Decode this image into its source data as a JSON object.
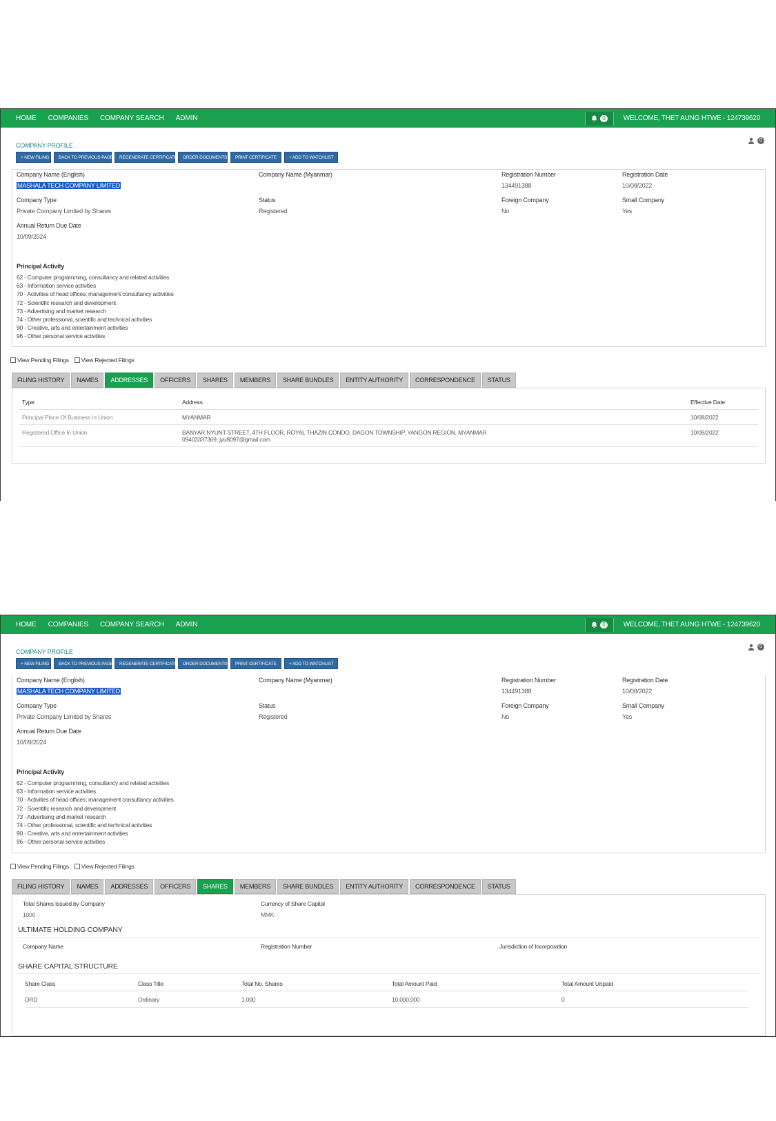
{
  "nav": {
    "links": [
      "HOME",
      "COMPANIES",
      "COMPANY SEARCH",
      "ADMIN"
    ],
    "notification_count": "0",
    "welcome": "WELCOME, THET AUNG HTWE - 124739620"
  },
  "profile": {
    "title": "COMPANY PROFILE",
    "info_count": "0",
    "buttons": [
      "+ NEW FILING",
      "BACK TO PREVIOUS PAGE",
      "REGENERATE CERTIFICATE",
      "ORDER DOCUMENTS",
      "PRINT CERTIFICATE",
      "+ ADD TO WATCHLIST"
    ]
  },
  "company": {
    "name_en_label": "Company Name (English)",
    "name_en": "MASHALA TECH COMPANY LIMITED",
    "name_mm_label": "Company Name (Myanmar)",
    "reg_no_label": "Registration Number",
    "reg_no": "134491388",
    "reg_date_label": "Registration Date",
    "reg_date": "10/08/2022",
    "type_label": "Company Type",
    "type": "Private Company Limited by Shares",
    "status_label": "Status",
    "status": "Registered",
    "foreign_label": "Foreign Company",
    "foreign": "No",
    "small_label": "Small Company",
    "small": "Yes",
    "arr_label": "Annual Return Due Date",
    "arr": "10/09/2024",
    "activity_label": "Principal Activity",
    "activities": [
      "62 - Computer programming, consultancy and related activities",
      "63 - Information service activities",
      "70 - Activities of head offices; management consultancy activities",
      "72 - Scientific research and development",
      "73 - Advertising and market research",
      "74 - Other professional, scientific and technical activities",
      "90 - Creative, arts and entertainment activities",
      "96 - Other personal service activities"
    ]
  },
  "filters": {
    "pending": "View Pending Filings",
    "rejected": "View Rejected Filings"
  },
  "tabs": [
    "FILING HISTORY",
    "NAMES",
    "ADDRESSES",
    "OFFICERS",
    "SHARES",
    "MEMBERS",
    "SHARE BUNDLES",
    "ENTITY AUTHORITY",
    "CORRESPONDENCE",
    "STATUS"
  ],
  "addresses": {
    "headers": [
      "Type",
      "Address",
      "Effective Date"
    ],
    "rows": [
      {
        "type": "Principal Place Of Business In Union",
        "address": "MYANMAR",
        "address2": "",
        "date": "10/08/2022"
      },
      {
        "type": "Registered Office In Union",
        "address": "BANYAR NYUNT STREET, 4TH FLOOR, ROYAL THAZIN CONDO, DAGON TOWNSHIP, YANGON REGION, MYANMAR",
        "address2": "09403337369, jyu8097@gmail.com",
        "date": "10/08/2022"
      }
    ]
  },
  "shares": {
    "total_label": "Total Shares Issued by Company",
    "total": "1000",
    "currency_label": "Currency of Share Capital",
    "currency": "MMK",
    "uhc_title": "ULTIMATE HOLDING COMPANY",
    "uhc_headers": [
      "Company Name",
      "Registration Number",
      "Jurisdiction of Incorporation"
    ],
    "scs_title": "SHARE CAPITAL STRUCTURE",
    "scs_headers": [
      "Share Class",
      "Class Title",
      "Total No. Shares",
      "Total Amount Paid",
      "Total Amount Unpaid"
    ],
    "scs_rows": [
      [
        "ORD",
        "Ordinary",
        "1,000",
        "10,000,000",
        "0"
      ]
    ]
  }
}
